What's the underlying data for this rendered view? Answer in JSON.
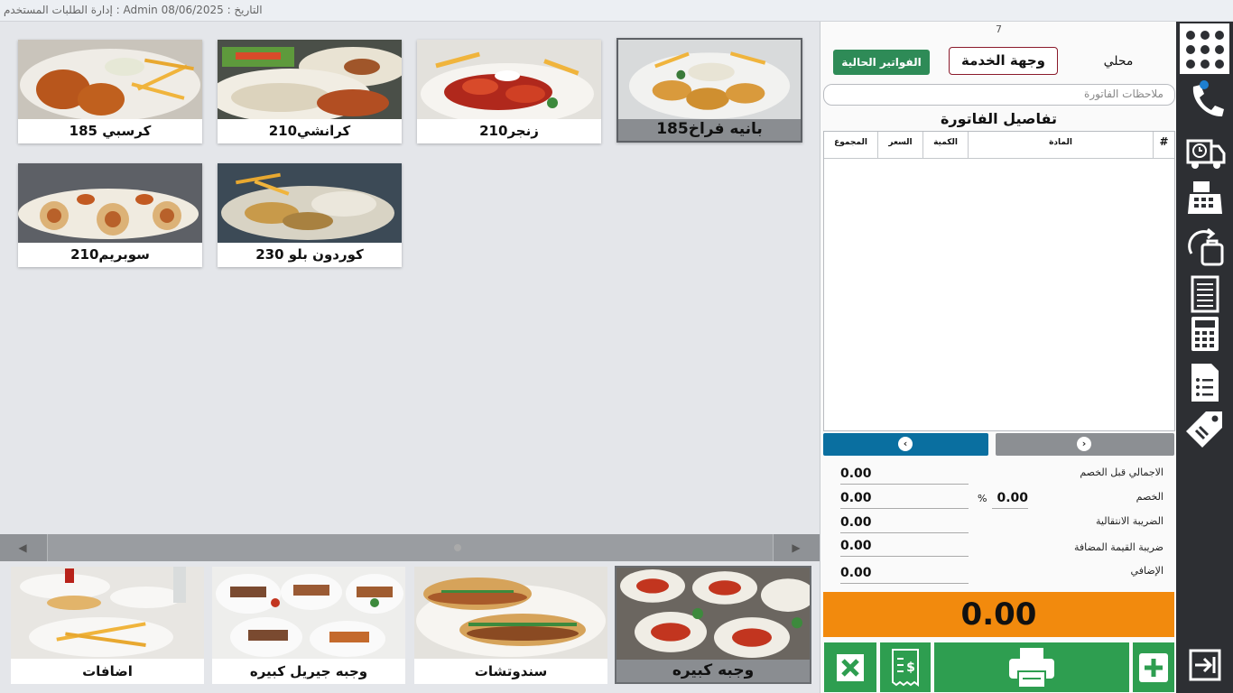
{
  "titlebar": {
    "text": "إدارة الطلبات المستخدم : Admin التاريخ : 08/06/2025"
  },
  "products": [
    {
      "label": "بانيه فراخ185",
      "selected": true
    },
    {
      "label": "زنجر210",
      "selected": false
    },
    {
      "label": "كرانشي210",
      "selected": false
    },
    {
      "label": "كرسبي 185",
      "selected": false
    },
    {
      "label": "كوردون بلو 230",
      "selected": false
    },
    {
      "label": "سوبريم210",
      "selected": false
    }
  ],
  "categories": [
    {
      "label": "وجبه كبيره",
      "selected": true
    },
    {
      "label": "سندوتشات",
      "selected": false
    },
    {
      "label": "وجبه جيريل كبيره",
      "selected": false
    },
    {
      "label": "اضافات",
      "selected": false
    }
  ],
  "order": {
    "number": "7",
    "current_invoices_label": "الفواتير الحالية",
    "service_label": "وجهة الخدمة",
    "service_value": "محلي",
    "notes_placeholder": "ملاحظات الفاتورة",
    "details_title": "تفاصيل الفاتورة",
    "columns": {
      "num": "#",
      "item": "المادة",
      "qty": "الكمية",
      "price": "السعر",
      "total": "المجموع"
    }
  },
  "totals": {
    "subtotal_label": "الاجمالي قبل الخصم",
    "subtotal": "0.00",
    "discount_label": "الخصم",
    "discount": "0.00",
    "discount_pct": "0.00",
    "pct_sign": "%",
    "transition_tax_label": "الضريبة الانتقالية",
    "transition_tax": "0.00",
    "vat_label": "ضريبة القيمة المضافة",
    "vat": "0.00",
    "extra_label": "الإضافي",
    "extra": "0.00",
    "grand_total": "0.00"
  },
  "colors": {
    "accent_green": "#2e9e50",
    "total_orange": "#f28a0d",
    "pager_blue": "#0a6fa0",
    "rail": "#2d2f33"
  },
  "rail_icons": [
    "apps-grid-icon",
    "phone-icon",
    "delivery-truck-icon",
    "cash-register-icon",
    "return-bag-icon",
    "receipt-list-icon",
    "calculator-icon",
    "document-list-icon",
    "price-tag-icon",
    "logout-icon"
  ]
}
